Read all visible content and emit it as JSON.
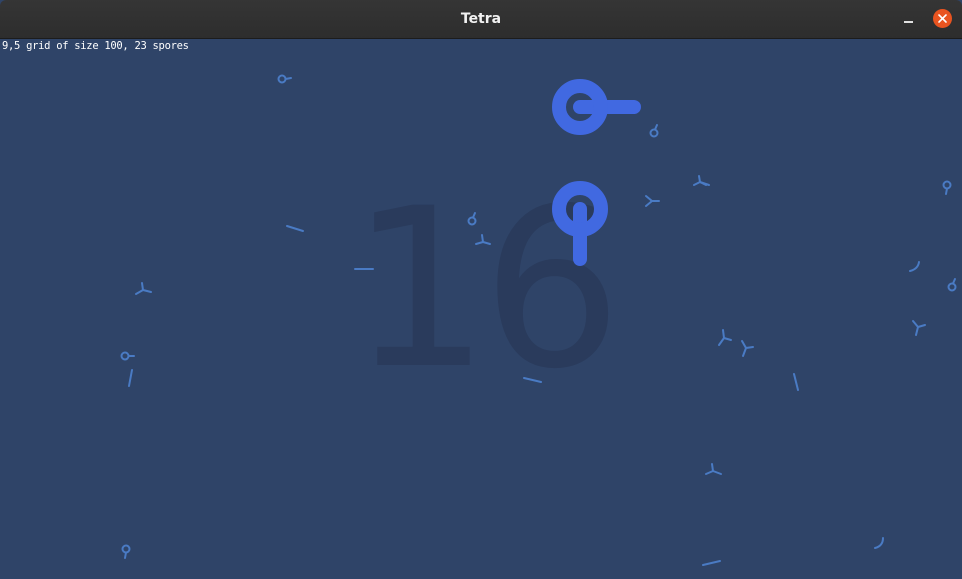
{
  "window": {
    "title": "Tetra",
    "minimize_icon": "minimize-icon",
    "close_icon": "close-icon",
    "close_color": "#e95420"
  },
  "scene": {
    "background": "#2f4468",
    "info_text": "9,5 grid of size 100, 23 spores",
    "counter": "16",
    "player_color": "#4169e1",
    "spore_color": "#4a7bc4"
  }
}
